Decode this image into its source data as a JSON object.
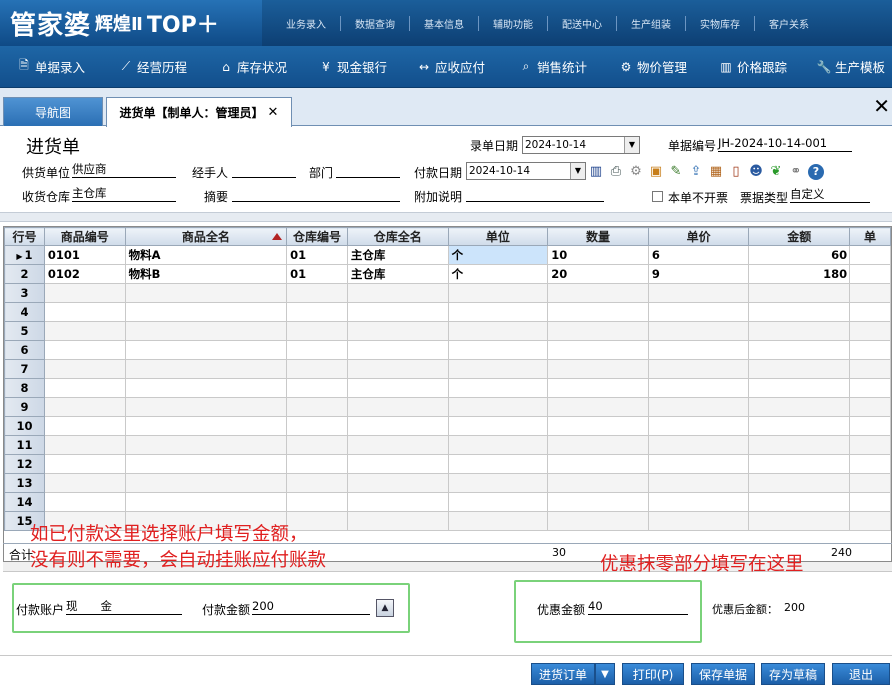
{
  "brand": {
    "name": "管家婆",
    "edition": "辉煌Ⅱ",
    "suffix": "TOP＋"
  },
  "top_menu": [
    "业务录入",
    "数据查询",
    "基本信息",
    "辅助功能",
    "配送中心",
    "生产组装",
    "实物库存",
    "客户关系"
  ],
  "toolbar": [
    {
      "label": "单据录入",
      "icon": "document-icon"
    },
    {
      "label": "经营历程",
      "icon": "chart-icon"
    },
    {
      "label": "库存状况",
      "icon": "house-icon"
    },
    {
      "label": "现金银行",
      "icon": "yen-icon"
    },
    {
      "label": "应收应付",
      "icon": "arrows-icon"
    },
    {
      "label": "销售统计",
      "icon": "search-icon"
    },
    {
      "label": "物价管理",
      "icon": "gear-icon"
    },
    {
      "label": "价格跟踪",
      "icon": "bar-chart-icon"
    },
    {
      "label": "生产模板",
      "icon": "wrench-icon"
    }
  ],
  "tabs": {
    "nav": "导航图",
    "purchase": "进货单【制单人：管理员】",
    "close": "✕"
  },
  "form": {
    "title": "进货单",
    "entry_date_label": "录单日期",
    "entry_date": "2024-10-14",
    "doc_no_label": "单据编号",
    "doc_no": "JH-2024-10-14-001",
    "supplier_label": "供货单位",
    "supplier": "供应商",
    "handler_label": "经手人",
    "handler": "",
    "dept_label": "部门",
    "dept": "",
    "pay_date_label": "付款日期",
    "pay_date": "2024-10-14",
    "warehouse_label": "收货仓库",
    "warehouse": "主仓库",
    "summary_label": "摘要",
    "summary": "",
    "note_label": "附加说明",
    "note": "",
    "no_invoice_label": "本单不开票",
    "bill_type_label": "票据类型",
    "bill_type": "自定义"
  },
  "grid": {
    "columns": [
      "行号",
      "商品编号",
      "商品全名",
      "仓库编号",
      "仓库全名",
      "单位",
      "数量",
      "单价",
      "金额",
      "单"
    ],
    "rows": [
      {
        "no": "1",
        "code": "0101",
        "name": "物料A",
        "wh_code": "01",
        "wh_name": "主仓库",
        "unit": "个",
        "qty": "10",
        "price": "6",
        "amount": "60"
      },
      {
        "no": "2",
        "code": "0102",
        "name": "物料B",
        "wh_code": "01",
        "wh_name": "主仓库",
        "unit": "个",
        "qty": "20",
        "price": "9",
        "amount": "180"
      }
    ],
    "empty_rows": [
      "3",
      "4",
      "5",
      "6",
      "7",
      "8",
      "9",
      "10",
      "11",
      "12",
      "13",
      "14",
      "15"
    ],
    "total_label": "合计",
    "total_qty": "30",
    "total_amount": "240"
  },
  "annotations": {
    "line1": "如已付款这里选择账户填写金额，",
    "line2": "没有则不需要，会自动挂账应付账款",
    "line3": "优惠抹零部分填写在这里"
  },
  "payment": {
    "account_label": "付款账户",
    "account": "现　　金",
    "amount_label": "付款金额",
    "amount": "200",
    "discount_label": "优惠金额",
    "discount": "40",
    "after_label": "优惠后金额：",
    "after": "200"
  },
  "buttons": {
    "order": "进货订单",
    "print": "打印(P)",
    "save": "保存单据",
    "draft": "存为草稿",
    "exit": "退出"
  },
  "colors": {
    "header_bg": "#124f8c",
    "annotation": "#e02020",
    "highlight_box": "#7ad27a",
    "selected_cell": "#cce4fb"
  }
}
